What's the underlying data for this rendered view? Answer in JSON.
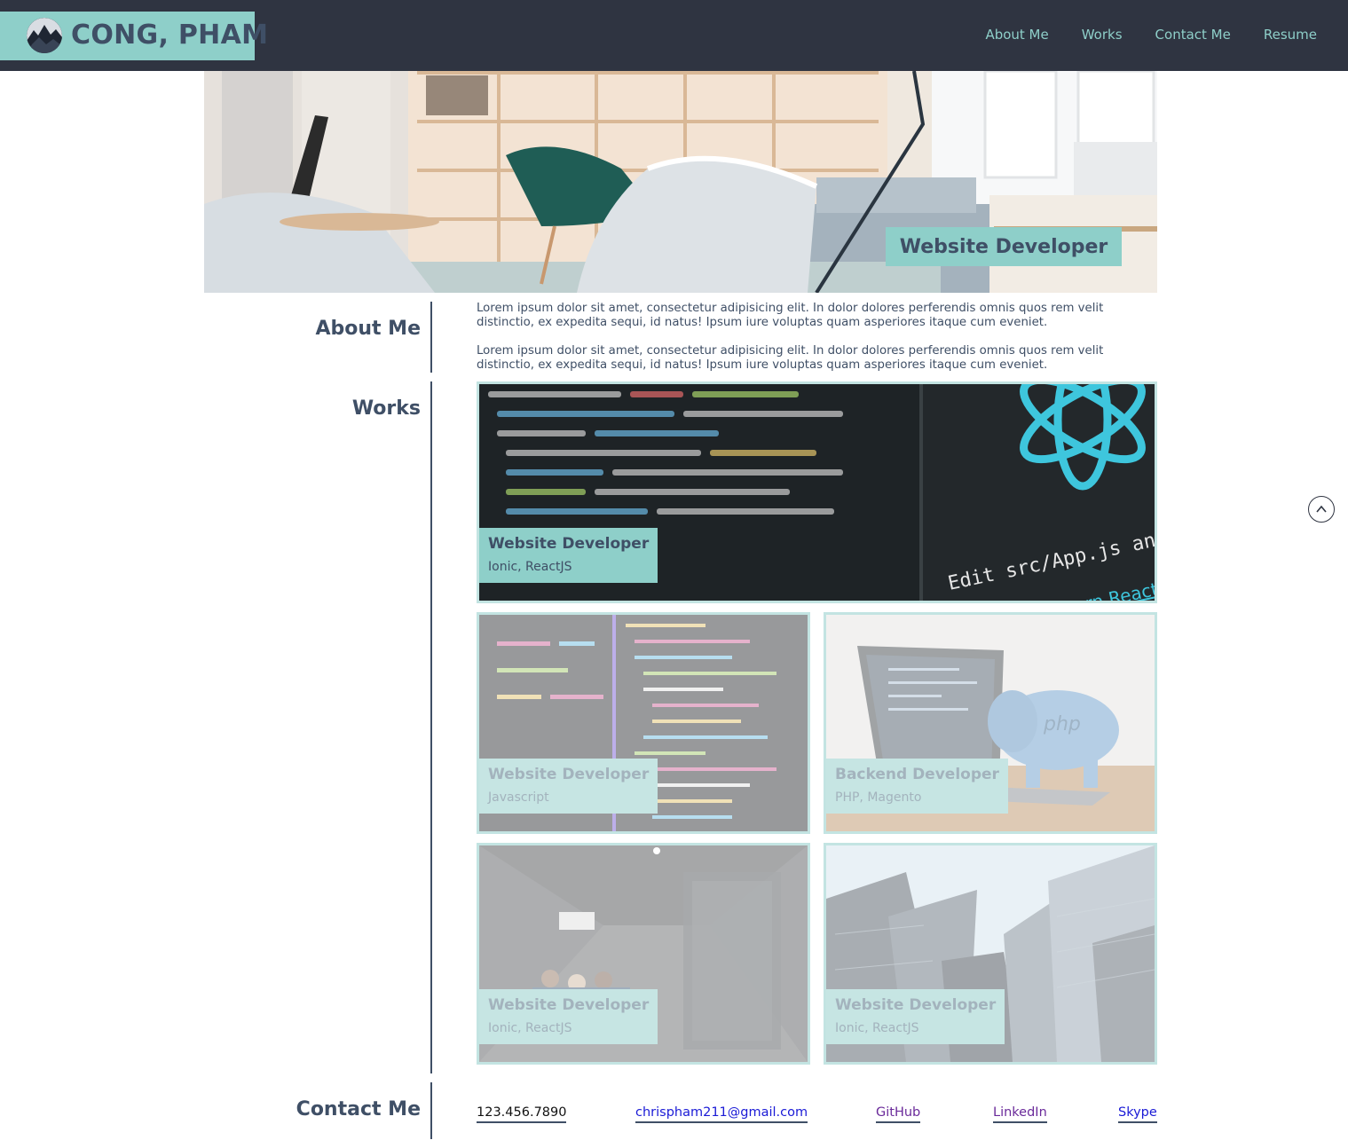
{
  "header": {
    "brand_name": "CONG, PHAM",
    "nav": [
      {
        "label": "About Me"
      },
      {
        "label": "Works"
      },
      {
        "label": "Contact Me"
      },
      {
        "label": "Resume"
      }
    ]
  },
  "hero": {
    "badge": "Website Developer"
  },
  "about": {
    "title": "About Me",
    "paragraphs": [
      "Lorem ipsum dolor sit amet, consectetur adipisicing elit. In dolor dolores perferendis omnis quos rem velit distinctio, ex expedita sequi, id natus! Ipsum iure voluptas quam asperiores itaque cum eveniet.",
      "Lorem ipsum dolor sit amet, consectetur adipisicing elit. In dolor dolores perferendis omnis quos rem velit distinctio, ex expedita sequi, id natus! Ipsum iure voluptas quam asperiores itaque cum eveniet."
    ]
  },
  "works": {
    "title": "Works",
    "items": [
      {
        "title": "Website Developer",
        "tech": "Ionic, ReactJS",
        "image": "react-code-screen"
      },
      {
        "title": "Website Developer",
        "tech": "Javascript",
        "image": "code-editor-screen"
      },
      {
        "title": "Backend Developer",
        "tech": "PHP, Magento",
        "image": "php-elephant-laptop"
      },
      {
        "title": "Website Developer",
        "tech": "Ionic, ReactJS",
        "image": "office-corridor"
      },
      {
        "title": "Website Developer",
        "tech": "Ionic, ReactJS",
        "image": "skyscrapers"
      }
    ],
    "react_screen_text": "Edit src/App.js and save",
    "react_link_text": "Learn React"
  },
  "contact": {
    "title": "Contact Me",
    "phone": "123.456.7890",
    "email": "chrispham211@gmail.com",
    "github": "GitHub",
    "linkedin": "LinkedIn",
    "skype": "Skype"
  },
  "colors": {
    "header_bg": "#2f3441",
    "accent": "#8ecfc9",
    "text": "#3f4f66",
    "card_border": "#c3e4e2"
  },
  "icons": {
    "back_to_top": "chevron-up-circle-icon"
  }
}
